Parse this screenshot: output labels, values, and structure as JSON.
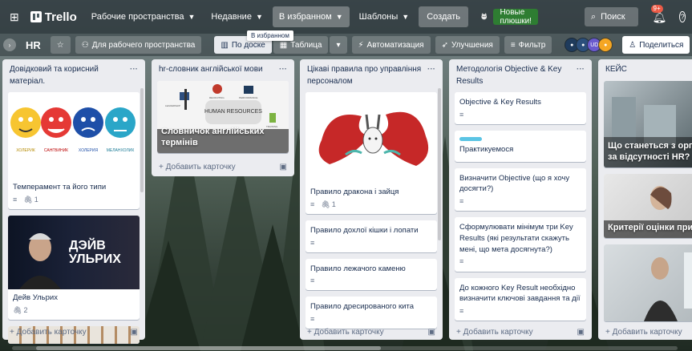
{
  "topbar": {
    "logo": "Trello",
    "workspaces": "Рабочие пространства",
    "recent": "Недавние",
    "starred": "В избранном",
    "templates": "Шаблоны",
    "create": "Создать",
    "promo": "Новые плюшки!",
    "search_placeholder": "Поиск",
    "notifications_count": "9+",
    "tooltip": "В избранном"
  },
  "boardbar": {
    "board_name": "HR",
    "visibility": "Для рабочего пространства",
    "view_board": "По доске",
    "view_table": "Таблица",
    "automation": "Автоматизация",
    "improvements": "Улучшения",
    "filter": "Фильтр",
    "avatar_initials": "UD",
    "share": "Поделиться"
  },
  "lists": [
    {
      "title": "Довідковий та корисний матеріал.",
      "cards": [
        {
          "title": "Темперамент та його типи",
          "attachments": "1",
          "cover_labels": [
            "ХОЛЕРИК",
            "САНГВИНИК",
            "ХОЛЕРИЯ",
            "МЕЛАНХОЛИК"
          ]
        },
        {
          "title": "Дейв Ульрих",
          "attachments": "2",
          "cover_text": "ДЭЙВ УЛЬРИХ"
        }
      ],
      "add_card": "Добавить карточку"
    },
    {
      "title": "hr-словник англійської мови",
      "cards": [
        {
          "title": "Словничок англійських термінів",
          "cover_text": "HUMAN RESOURCES",
          "cover_labels": [
            "LEADERSHIP",
            "RECRUITING",
            "PERFORMANCE",
            "TRAINING"
          ]
        }
      ],
      "add_card": "Добавить карточку"
    },
    {
      "title": "Цікаві правила про управління персоналом",
      "cards": [
        {
          "title": "Правило дракона і зайця",
          "attachments": "1"
        },
        {
          "title": "Правило дохлої кішки і лопати"
        },
        {
          "title": "Правило лежачого каменю"
        },
        {
          "title": "Правило дресированого кита"
        }
      ],
      "add_card": "Добавить карточку"
    },
    {
      "title": "Методологія Objective & Key Results",
      "cards": [
        {
          "title": "Objective & Key Results"
        },
        {
          "title": "Практикуемося"
        },
        {
          "title": "Визначити Objective (що я хочу досягти?)"
        },
        {
          "title": "Сформулювати мінімум три Key Results (які результати скажуть мені, що мета досягнута?)"
        },
        {
          "title": "До кожного Key Result необхідно визначити ключові завдання та дії"
        }
      ],
      "add_card": "Добавить карточку"
    },
    {
      "title": "КЕЙС",
      "cards": [
        {
          "title": "Що станеться з організацією за відсутності HR?"
        },
        {
          "title": "Критерії оцінки при підборі"
        }
      ],
      "add_card": "Добавить карточку"
    }
  ],
  "colors": {
    "promo": "#2e7d32",
    "label_blue": "#5bc4e4",
    "badge_red": "#eb5a46"
  }
}
